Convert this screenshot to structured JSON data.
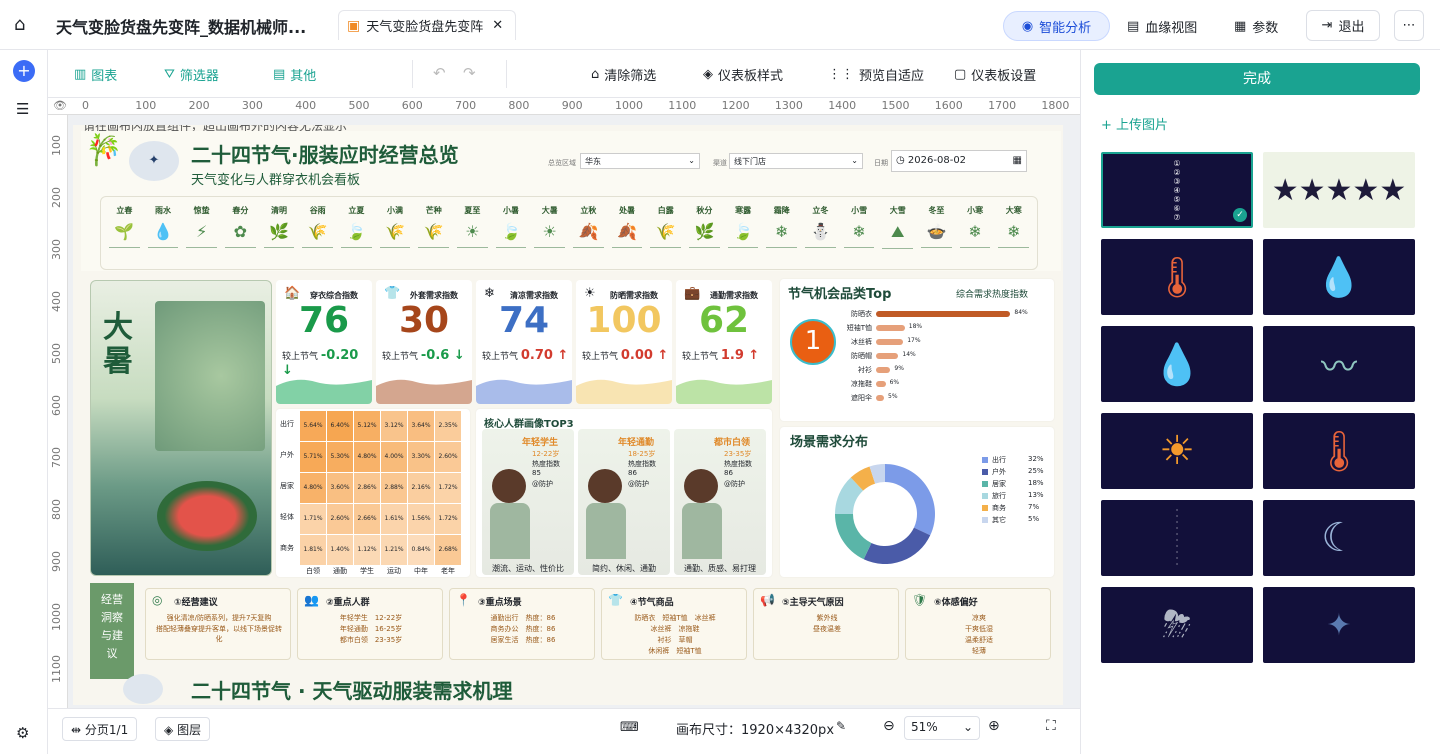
{
  "header": {
    "title": "天气变脸货盘先变阵_数据机械师...",
    "tab_label": "天气变脸货盘先变阵",
    "ai_label": "智能分析",
    "lineage_label": "血缘视图",
    "params_label": "参数",
    "exit_label": "退出"
  },
  "toolbar": {
    "chart": "图表",
    "filter": "筛选器",
    "other": "其他",
    "clear_filter": "清除筛选",
    "dashboard_style": "仪表板样式",
    "preview_fit": "预览自适应",
    "dashboard_settings": "仪表板设置"
  },
  "ruler": {
    "ticks": [
      "0",
      "100",
      "200",
      "300",
      "400",
      "500",
      "600",
      "700",
      "800",
      "900",
      "1000",
      "1100",
      "1200",
      "1300",
      "1400",
      "1500",
      "1600",
      "1700",
      "1800",
      "1900"
    ],
    "vticks": [
      "100",
      "200",
      "300",
      "400",
      "500",
      "600",
      "700",
      "800",
      "900",
      "1000",
      "1100"
    ]
  },
  "canvas": {
    "hint": "请在画布内放置组件，超出画布外的内容无法显示",
    "title": "二十四节气·服装应时经营总览",
    "subtitle": "天气变化与人群穿衣机会看板",
    "filters": {
      "region_label": "总览区域",
      "region_value": "华东",
      "channel_label": "渠道",
      "channel_value": "线下门店",
      "date_label": "日期",
      "date_value": "2026-08-02"
    },
    "solar_terms": [
      "立春",
      "雨水",
      "惊蛰",
      "春分",
      "清明",
      "谷雨",
      "立夏",
      "小满",
      "芒种",
      "夏至",
      "小暑",
      "大暑",
      "立秋",
      "处暑",
      "白露",
      "秋分",
      "寒露",
      "霜降",
      "立冬",
      "小雪",
      "大雪",
      "冬至",
      "小寒",
      "大寒"
    ],
    "solar_icons": [
      "🌱",
      "💧",
      "⚡",
      "✿",
      "🌿",
      "🌾",
      "🍃",
      "🌾",
      "🌾",
      "☀",
      "🍃",
      "☀",
      "🍂",
      "🍂",
      "🌾",
      "🌿",
      "🍃",
      "❄",
      "⛄",
      "❄",
      "⛰",
      "🍲",
      "❄",
      "❄"
    ],
    "poster": {
      "big": "大暑"
    },
    "kpis": [
      {
        "label": "穿衣综合指数",
        "value": "76",
        "delta_label": "较上节气",
        "delta": "-0.20",
        "color": "#1a9a4a",
        "arrow": "↓",
        "icon": "🏠",
        "delta_color": "#1a9a4a",
        "area_color": "#2fb36a"
      },
      {
        "label": "外套需求指数",
        "value": "30",
        "delta_label": "较上节气",
        "delta": "-0.6",
        "color": "#a6461b",
        "arrow": "↓",
        "icon": "👕",
        "delta_color": "#1a9a4a",
        "area_color": "#b86a45"
      },
      {
        "label": "清凉需求指数",
        "value": "74",
        "delta_label": "较上节气",
        "delta": "0.70",
        "color": "#3d6fc4",
        "arrow": "↑",
        "icon": "❄",
        "delta_color": "#d23b2e",
        "area_color": "#6f8fdc"
      },
      {
        "label": "防晒需求指数",
        "value": "100",
        "delta_label": "较上节气",
        "delta": "0.00",
        "color": "#f2c760",
        "arrow": "↑",
        "icon": "☀",
        "delta_color": "#d23b2e",
        "area_color": "#f4d27f"
      },
      {
        "label": "通勤需求指数",
        "value": "62",
        "delta_label": "较上节气",
        "delta": "1.9",
        "color": "#6fc23d",
        "arrow": "↑",
        "icon": "💼",
        "delta_color": "#d23b2e",
        "area_color": "#8fd06a"
      }
    ],
    "heatmap": {
      "rows": [
        "出行",
        "户外",
        "居家",
        "轻体",
        "商务"
      ],
      "cols": [
        "白领",
        "通勤",
        "学生",
        "运动",
        "中年",
        "老年"
      ],
      "values": [
        [
          "5.64%",
          "6.40%",
          "5.12%",
          "3.12%",
          "3.64%",
          "2.35%"
        ],
        [
          "5.71%",
          "5.30%",
          "4.80%",
          "4.00%",
          "3.30%",
          "2.60%"
        ],
        [
          "4.80%",
          "3.60%",
          "2.86%",
          "2.88%",
          "2.16%",
          "1.72%"
        ],
        [
          "1.71%",
          "2.60%",
          "2.66%",
          "1.61%",
          "1.56%",
          "1.72%"
        ],
        [
          "1.81%",
          "1.40%",
          "1.12%",
          "1.21%",
          "0.84%",
          "2.68%"
        ]
      ]
    },
    "top_members": {
      "title": "节气机会品类Top",
      "subtitle": "综合需求热度指数",
      "items": [
        {
          "name": "防晒衣",
          "pct": "84%",
          "v": 84
        },
        {
          "name": "短袖T恤",
          "pct": "18%",
          "v": 18
        },
        {
          "name": "冰丝裤",
          "pct": "17%",
          "v": 17
        },
        {
          "name": "防晒帽",
          "pct": "14%",
          "v": 14
        },
        {
          "name": "衬衫",
          "pct": "9%",
          "v": 9
        },
        {
          "name": "凉拖鞋",
          "pct": "6%",
          "v": 6
        },
        {
          "name": "遮阳伞",
          "pct": "5%",
          "v": 5
        }
      ]
    },
    "persona": {
      "title": "核心人群画像TOP3",
      "people": [
        {
          "role": "年轻学生",
          "age": "12-22岁",
          "tag": "热度指数",
          "score": "85",
          "line": "@防护",
          "foot": "潮流、运动、性价比"
        },
        {
          "role": "年轻通勤",
          "age": "18-25岁",
          "tag": "热度指数",
          "score": "86",
          "line": "@防护",
          "foot": "简约、休闲、通勤"
        },
        {
          "role": "都市白领",
          "age": "23-35岁",
          "tag": "热度指数",
          "score": "86",
          "line": "@防护",
          "foot": "通勤、质感、易打理"
        }
      ]
    },
    "scene": {
      "title": "场景需求分布",
      "legend": [
        {
          "name": "出行",
          "pct": "32%",
          "color": "#7c9be8"
        },
        {
          "name": "户外",
          "pct": "25%",
          "color": "#4a5ba8"
        },
        {
          "name": "居家",
          "pct": "18%",
          "color": "#5ab5a8"
        },
        {
          "name": "旅行",
          "pct": "13%",
          "color": "#a8d8e0"
        },
        {
          "name": "商务",
          "pct": "7%",
          "color": "#f4b04a"
        },
        {
          "name": "其它",
          "pct": "5%",
          "color": "#c8d6ee"
        }
      ],
      "labels": [
        "32.0%",
        "25.00%",
        "13.00%",
        "7.00%"
      ]
    },
    "bottom": {
      "vertical": "经营洞察与建议",
      "blocks": [
        {
          "title": "①经营建议",
          "icon": "◎",
          "lines": [
            "强化清凉/防晒系列，提升7天复购",
            "搭配轻薄叠穿提升客单，以线下场景促转化"
          ]
        },
        {
          "title": "②重点人群",
          "icon": "👥",
          "lines": [
            "年轻学生　12-22岁",
            "年轻通勤　16-25岁",
            "都市白领　23-35岁"
          ]
        },
        {
          "title": "③重点场景",
          "icon": "📍",
          "lines": [
            "通勤出行　热度：86",
            "商务办公　热度：86",
            "居家生活　热度：86"
          ]
        },
        {
          "title": "④节气商品",
          "icon": "👕",
          "lines": [
            "防晒衣　短袖T恤　冰丝裤",
            "冰丝裤　凉拖鞋",
            "衬衫　草帽",
            "休闲裤　短袖T恤"
          ]
        },
        {
          "title": "⑤主导天气原因",
          "icon": "📢",
          "lines": [
            "紫外线",
            "昼夜温差"
          ]
        },
        {
          "title": "⑥体感偏好",
          "icon": "🛡",
          "lines": [
            "凉爽",
            "干爽低湿",
            "温柔舒适",
            "轻薄"
          ]
        }
      ]
    },
    "footer_title": "二十四节气 · 天气驱动服装需求机理"
  },
  "bottom_bar": {
    "page": "分页1/1",
    "layers": "图层",
    "canvas_size": "画布尺寸：1920×4320px",
    "zoom": "51%"
  },
  "right_panel": {
    "done": "完成",
    "upload": "上传图片"
  }
}
